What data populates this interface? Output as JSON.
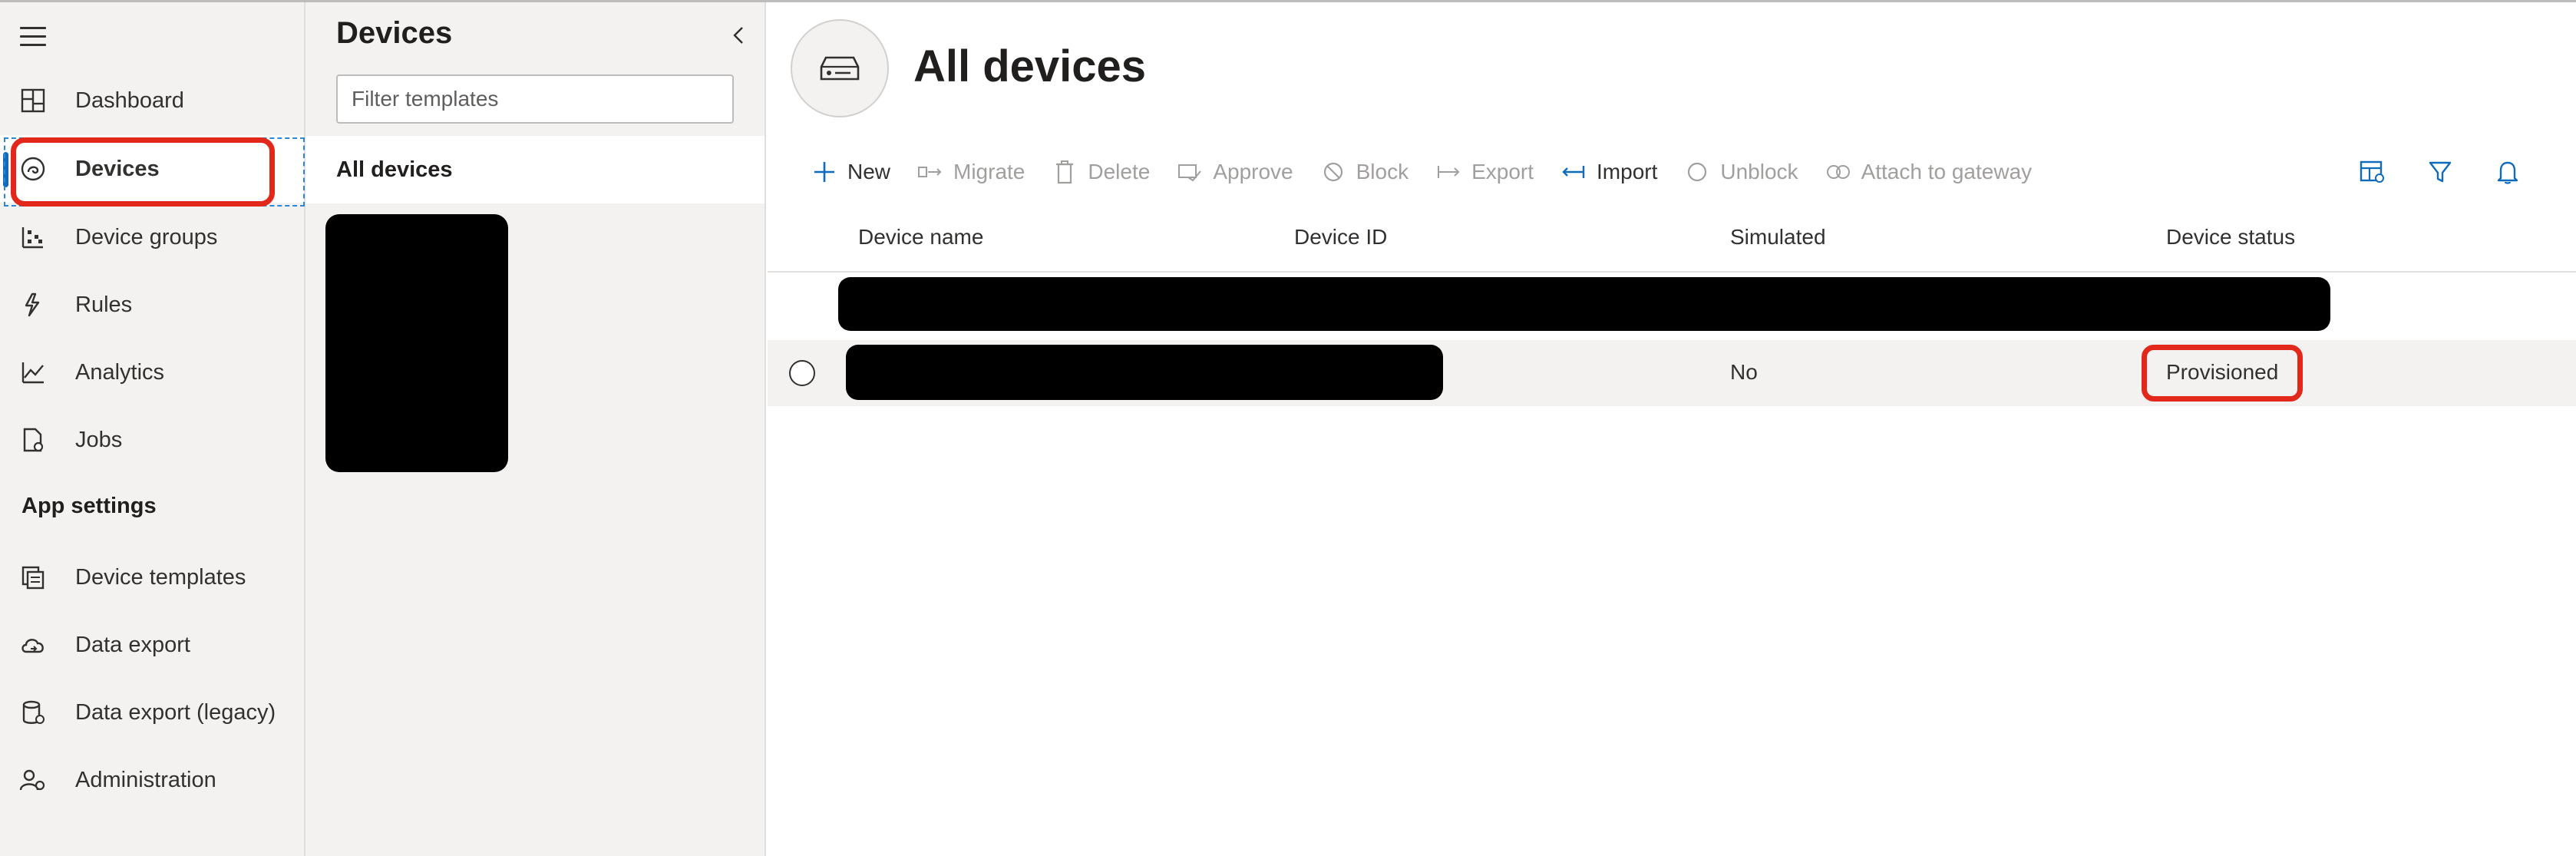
{
  "nav": {
    "items": [
      {
        "label": "Dashboard",
        "icon": "dashboard-icon"
      },
      {
        "label": "Devices",
        "icon": "devices-icon"
      },
      {
        "label": "Device groups",
        "icon": "device-groups-icon"
      },
      {
        "label": "Rules",
        "icon": "rules-icon"
      },
      {
        "label": "Analytics",
        "icon": "analytics-icon"
      },
      {
        "label": "Jobs",
        "icon": "jobs-icon"
      }
    ],
    "section_title": "App settings",
    "settings_items": [
      {
        "label": "Device templates",
        "icon": "device-templates-icon"
      },
      {
        "label": "Data export",
        "icon": "data-export-icon"
      },
      {
        "label": "Data export (legacy)",
        "icon": "data-export-legacy-icon"
      },
      {
        "label": "Administration",
        "icon": "administration-icon"
      }
    ],
    "active_item": "Devices"
  },
  "templates_pane": {
    "title": "Devices",
    "filter_placeholder": "Filter templates",
    "all_devices_label": "All devices"
  },
  "main": {
    "title": "All devices",
    "toolbar": [
      {
        "label": "New",
        "icon": "plus-icon",
        "enabled": true
      },
      {
        "label": "Migrate",
        "icon": "migrate-icon",
        "enabled": false
      },
      {
        "label": "Delete",
        "icon": "trash-icon",
        "enabled": false
      },
      {
        "label": "Approve",
        "icon": "approve-icon",
        "enabled": false
      },
      {
        "label": "Block",
        "icon": "block-icon",
        "enabled": false
      },
      {
        "label": "Export",
        "icon": "export-icon",
        "enabled": false
      },
      {
        "label": "Import",
        "icon": "import-icon",
        "enabled": true
      },
      {
        "label": "Unblock",
        "icon": "unblock-icon",
        "enabled": false
      },
      {
        "label": "Attach to gateway",
        "icon": "attach-icon",
        "enabled": false
      }
    ],
    "table": {
      "columns": [
        "Device name",
        "Device ID",
        "Simulated",
        "Device status"
      ],
      "rows": [
        {
          "simulated": "No",
          "status": "Provisioned"
        }
      ]
    }
  },
  "colors": {
    "accent": "#0f6cbd",
    "highlight": "#e2281b",
    "nav_bg": "#f3f2f1"
  }
}
